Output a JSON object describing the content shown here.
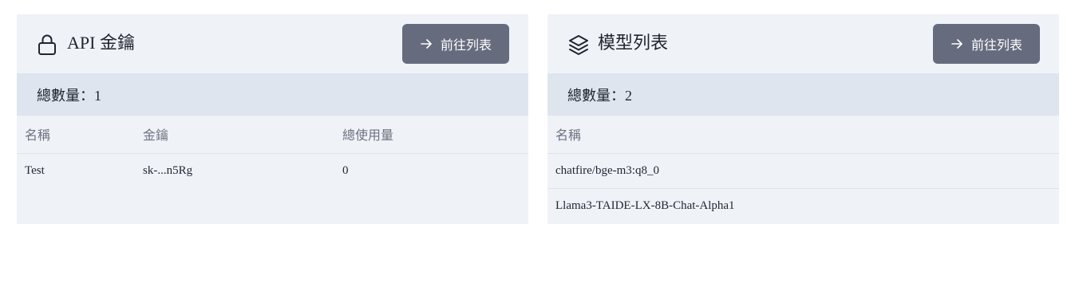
{
  "api_keys_card": {
    "title": "API 金鑰",
    "icon": "lock-icon",
    "button_label": "前往列表",
    "total_count_text": "總數量：1",
    "columns": [
      "名稱",
      "金鑰",
      "總使用量"
    ],
    "rows": [
      {
        "name": "Test",
        "key": "sk-...n5Rg",
        "usage": "0"
      }
    ]
  },
  "models_card": {
    "title": "模型列表",
    "icon": "layers-icon",
    "button_label": "前往列表",
    "total_count_text": "總數量：2",
    "columns": [
      "名稱"
    ],
    "rows": [
      {
        "name": "chatfire/bge-m3:q8_0"
      },
      {
        "name": "Llama3-TAIDE-LX-8B-Chat-Alpha1"
      }
    ]
  },
  "colors": {
    "card_background": "#eff3f8",
    "count_bar_background": "#dfe5ee",
    "button_background": "#676b7e",
    "header_text": "#6d7280"
  }
}
